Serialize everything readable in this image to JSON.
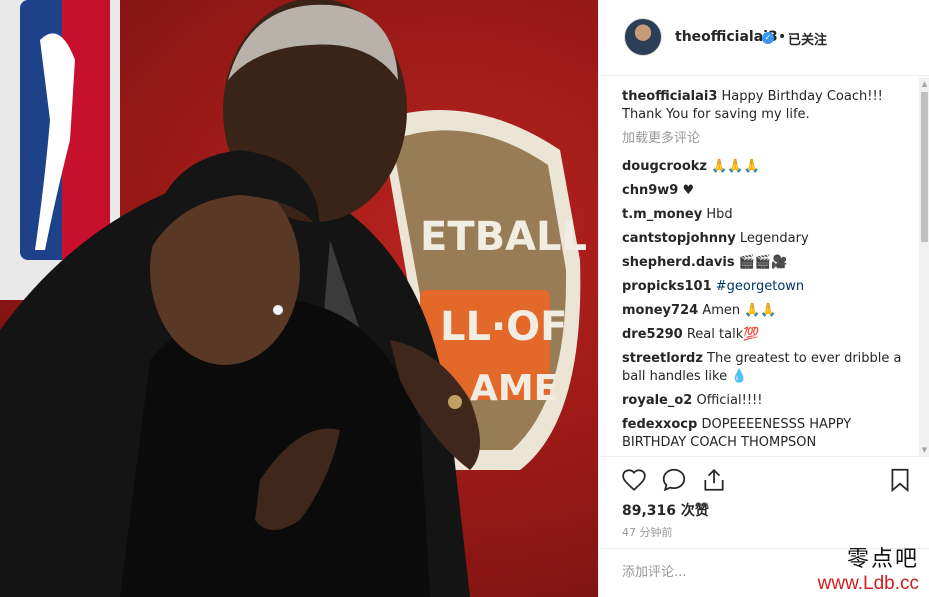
{
  "post": {
    "username": "theofficialai3",
    "follow_dot": "•",
    "follow_state": "已关注",
    "verified_glyph": "✓"
  },
  "photo": {
    "sign_text_lines": [
      "ETBALL",
      "LL·OF",
      "AME"
    ]
  },
  "caption": {
    "username": "theofficialai3",
    "text": "Happy Birthday Coach!!! Thank You for saving my life."
  },
  "load_more": "加载更多评论",
  "comments": [
    {
      "username": "dougcrookz",
      "text": "🙏🙏🙏"
    },
    {
      "username": "chn9w9",
      "text": "♥"
    },
    {
      "username": "t.m_money",
      "text": "Hbd"
    },
    {
      "username": "cantstopjohnny",
      "text": "Legendary"
    },
    {
      "username": "shepherd.davis",
      "text": "🎬🎬🎥"
    },
    {
      "username": "propicks101",
      "text": "#georgetown"
    },
    {
      "username": "money724",
      "text": "Amen 🙏🙏"
    },
    {
      "username": "dre5290",
      "text": "Real talk💯"
    },
    {
      "username": "streetlordz",
      "text": "The greatest to ever dribble a ball handles like 💧"
    },
    {
      "username": "royale_o2",
      "text": "Official!!!!"
    },
    {
      "username": "fedexxocp",
      "text": "DOPEEEENESSS HAPPY BIRTHDAY COACH THOMPSON"
    }
  ],
  "likes": "89,316 次赞",
  "time": "47 分钟前",
  "add_comment_placeholder": "添加评论...",
  "scroll": {
    "up": "▲",
    "down": "▼"
  },
  "watermark": {
    "top": "零点吧",
    "bottom": "www.Ldb.cc"
  },
  "colors": {
    "hashtag": "#003569",
    "verified": "#3897f0",
    "watermark_red": "#d01e1e"
  }
}
